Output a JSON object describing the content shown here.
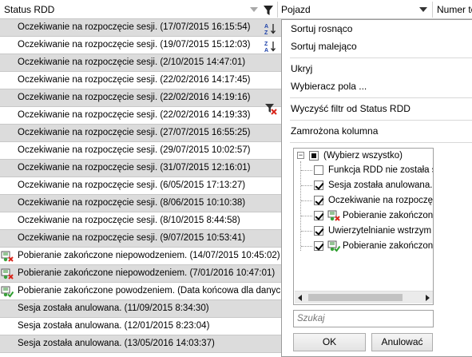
{
  "header": {
    "col1": "Status RDD",
    "col2": "Pojazd",
    "col3": "Numer te"
  },
  "rows": [
    {
      "text": "Oczekiwanie na rozpoczęcie sesji. (17/07/2015 16:15:54)",
      "icon": "",
      "alt": true
    },
    {
      "text": "Oczekiwanie na rozpoczęcie sesji. (19/07/2015 15:12:03)",
      "icon": "",
      "alt": false
    },
    {
      "text": "Oczekiwanie na rozpoczęcie sesji. (2/10/2015 14:47:01)",
      "icon": "",
      "alt": true
    },
    {
      "text": "Oczekiwanie na rozpoczęcie sesji. (22/02/2016 14:17:45)",
      "icon": "",
      "alt": false
    },
    {
      "text": "Oczekiwanie na rozpoczęcie sesji. (22/02/2016 14:19:16)",
      "icon": "",
      "alt": true
    },
    {
      "text": "Oczekiwanie na rozpoczęcie sesji. (22/02/2016 14:19:33)",
      "icon": "",
      "alt": false
    },
    {
      "text": "Oczekiwanie na rozpoczęcie sesji. (27/07/2015 16:55:25)",
      "icon": "",
      "alt": true
    },
    {
      "text": "Oczekiwanie na rozpoczęcie sesji. (29/07/2015 10:02:57)",
      "icon": "",
      "alt": false
    },
    {
      "text": "Oczekiwanie na rozpoczęcie sesji. (31/07/2015 12:16:01)",
      "icon": "",
      "alt": true
    },
    {
      "text": "Oczekiwanie na rozpoczęcie sesji. (6/05/2015 17:13:27)",
      "icon": "",
      "alt": false
    },
    {
      "text": "Oczekiwanie na rozpoczęcie sesji. (8/06/2015 10:10:38)",
      "icon": "",
      "alt": true
    },
    {
      "text": "Oczekiwanie na rozpoczęcie sesji. (8/10/2015 8:44:58)",
      "icon": "",
      "alt": false
    },
    {
      "text": "Oczekiwanie na rozpoczęcie sesji. (9/07/2015 10:53:41)",
      "icon": "",
      "alt": true
    },
    {
      "text": "Pobieranie zakończone niepowodzeniem. (14/07/2015 10:45:02)",
      "icon": "download-failed-icon",
      "alt": false
    },
    {
      "text": "Pobieranie zakończone niepowodzeniem. (7/01/2016 10:47:01)",
      "icon": "download-failed-icon",
      "alt": true
    },
    {
      "text": "Pobieranie zakończone powodzeniem. (Data końcowa dla danych",
      "icon": "download-success-icon",
      "alt": false
    },
    {
      "text": "Sesja została anulowana. (11/09/2015 8:34:30)",
      "icon": "",
      "alt": true
    },
    {
      "text": "Sesja została anulowana. (12/01/2015 8:23:04)",
      "icon": "",
      "alt": false
    },
    {
      "text": "Sesja została anulowana. (13/05/2016 14:03:37)",
      "icon": "",
      "alt": true
    }
  ],
  "menu": {
    "sort_asc": "Sortuj rosnąco",
    "sort_desc": "Sortuj malejąco",
    "hide": "Ukryj",
    "field_chooser": "Wybieracz pola ...",
    "clear_filter": "Wyczyść filtr od Status RDD",
    "frozen_column": "Zamrożona kolumna"
  },
  "filter_tree": {
    "select_all": "(Wybierz wszystko)",
    "items": [
      {
        "label": "Funkcja RDD nie została s",
        "checked": false,
        "icon": ""
      },
      {
        "label": "Sesja została anulowana.",
        "checked": true,
        "icon": ""
      },
      {
        "label": "Oczekiwanie na rozpoczę",
        "checked": true,
        "icon": ""
      },
      {
        "label": "Pobieranie zakończone",
        "checked": true,
        "icon": "download-failed-icon"
      },
      {
        "label": "Uwierzytelnianie wstrzym",
        "checked": true,
        "icon": ""
      },
      {
        "label": "Pobieranie zakończon",
        "checked": true,
        "icon": "download-success-icon"
      }
    ]
  },
  "search": {
    "placeholder": "Szukaj"
  },
  "buttons": {
    "ok": "OK",
    "cancel": "Anulować"
  }
}
